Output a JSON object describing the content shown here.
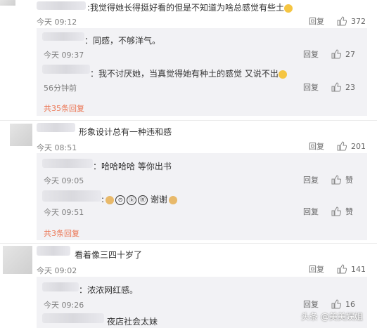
{
  "comments": [
    {
      "text": "我觉得她长得挺好看的但是不知道为啥总感觉有些土",
      "time": "今天 09:12",
      "reply_label": "回复",
      "likes": "372",
      "replies": [
        {
          "text": "同感，不够洋气。",
          "time": "今天 09:37",
          "reply_label": "回复",
          "likes": "27"
        },
        {
          "text": "我不讨厌她，当真觉得她有种土的感觉 又说不出",
          "time": "56分钟前",
          "reply_label": "回复",
          "likes": "23"
        }
      ],
      "more_replies": "共35条回复"
    },
    {
      "text": "形象设计总有一种违和感",
      "time": "今天 08:51",
      "reply_label": "回复",
      "likes": "201",
      "replies": [
        {
          "text": "哈哈哈哈 等你出书",
          "time": "今天 09:05",
          "reply_label": "回复",
          "likes": "赞"
        },
        {
          "text": "谢谢",
          "time": "今天 09:51",
          "reply_label": "回复",
          "likes": "赞"
        }
      ],
      "more_replies": "共3条回复"
    },
    {
      "text": "看着像三四十岁了",
      "time": "今天 09:02",
      "reply_label": "回复",
      "likes": "141",
      "replies": [
        {
          "text": "浓浓网红感。",
          "time": "今天 09:26",
          "reply_label": "回复",
          "likes": "16"
        },
        {
          "text": "夜店社会太妹"
        }
      ]
    }
  ],
  "watermark": "头条 @美美娱姐"
}
